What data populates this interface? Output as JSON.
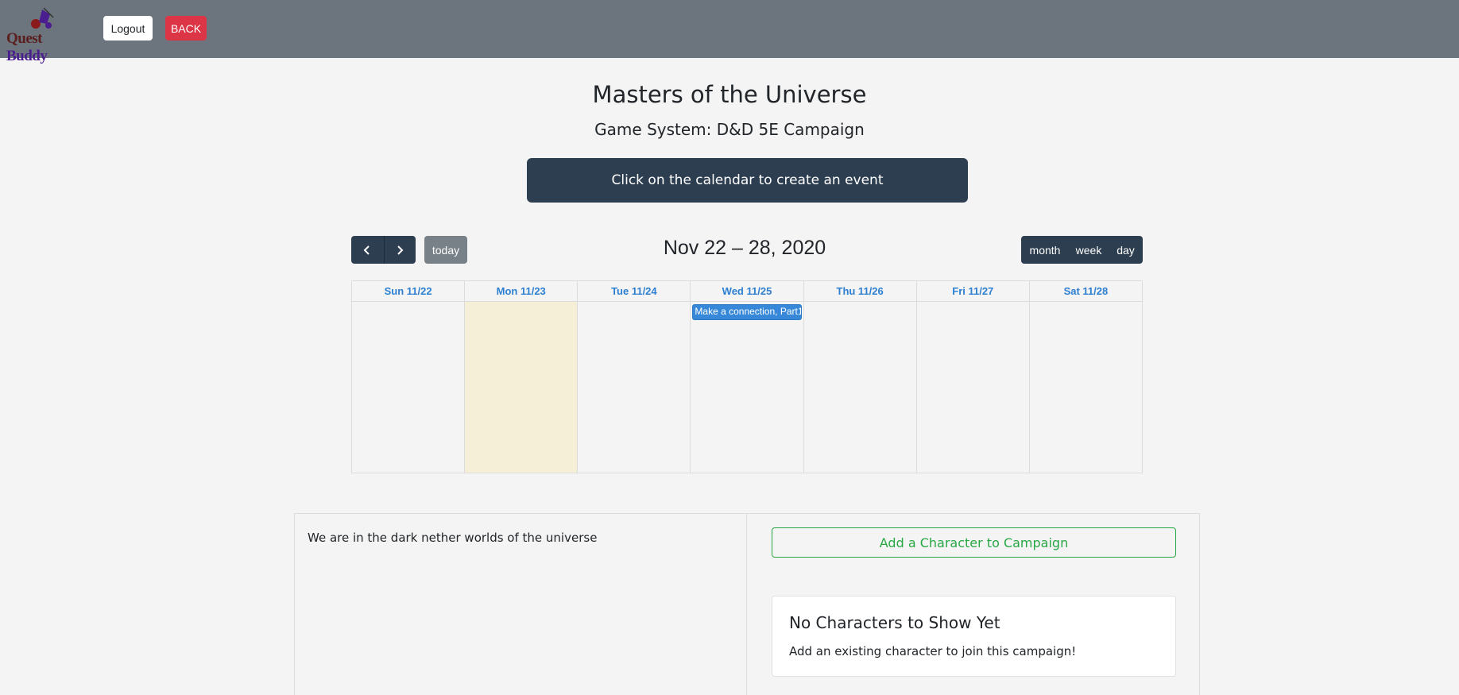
{
  "navbar": {
    "logo_text_part1": "Quest",
    "logo_text_part2": "Buddy",
    "logout_label": "Logout",
    "back_label": "BACK"
  },
  "campaign": {
    "title": "Masters of the Universe",
    "game_system": "Game System: D&D 5E Campaign",
    "banner": "Click on the calendar to create an event",
    "description": "We are in the dark nether worlds of the universe"
  },
  "calendar": {
    "today_label": "today",
    "range_title": "Nov 22 – 28, 2020",
    "views": {
      "month": "month",
      "week": "week",
      "day": "day"
    },
    "days": [
      {
        "label": "Sun 11/22"
      },
      {
        "label": "Mon 11/23"
      },
      {
        "label": "Tue 11/24"
      },
      {
        "label": "Wed 11/25"
      },
      {
        "label": "Thu 11/26"
      },
      {
        "label": "Fri 11/27"
      },
      {
        "label": "Sat 11/28"
      }
    ],
    "today_index": 1,
    "events": [
      {
        "day_index": 3,
        "title": "Make a connection, Part1"
      }
    ]
  },
  "characters": {
    "add_button": "Add a Character to Campaign",
    "empty_title": "No Characters to Show Yet",
    "empty_text": "Add an existing character to join this campaign!"
  },
  "colors": {
    "navbar": "#6c757d",
    "dark": "#2c3e50",
    "danger": "#dc3545",
    "success": "#28a745",
    "event": "#3788d8",
    "today_highlight": "#f5efd7"
  }
}
